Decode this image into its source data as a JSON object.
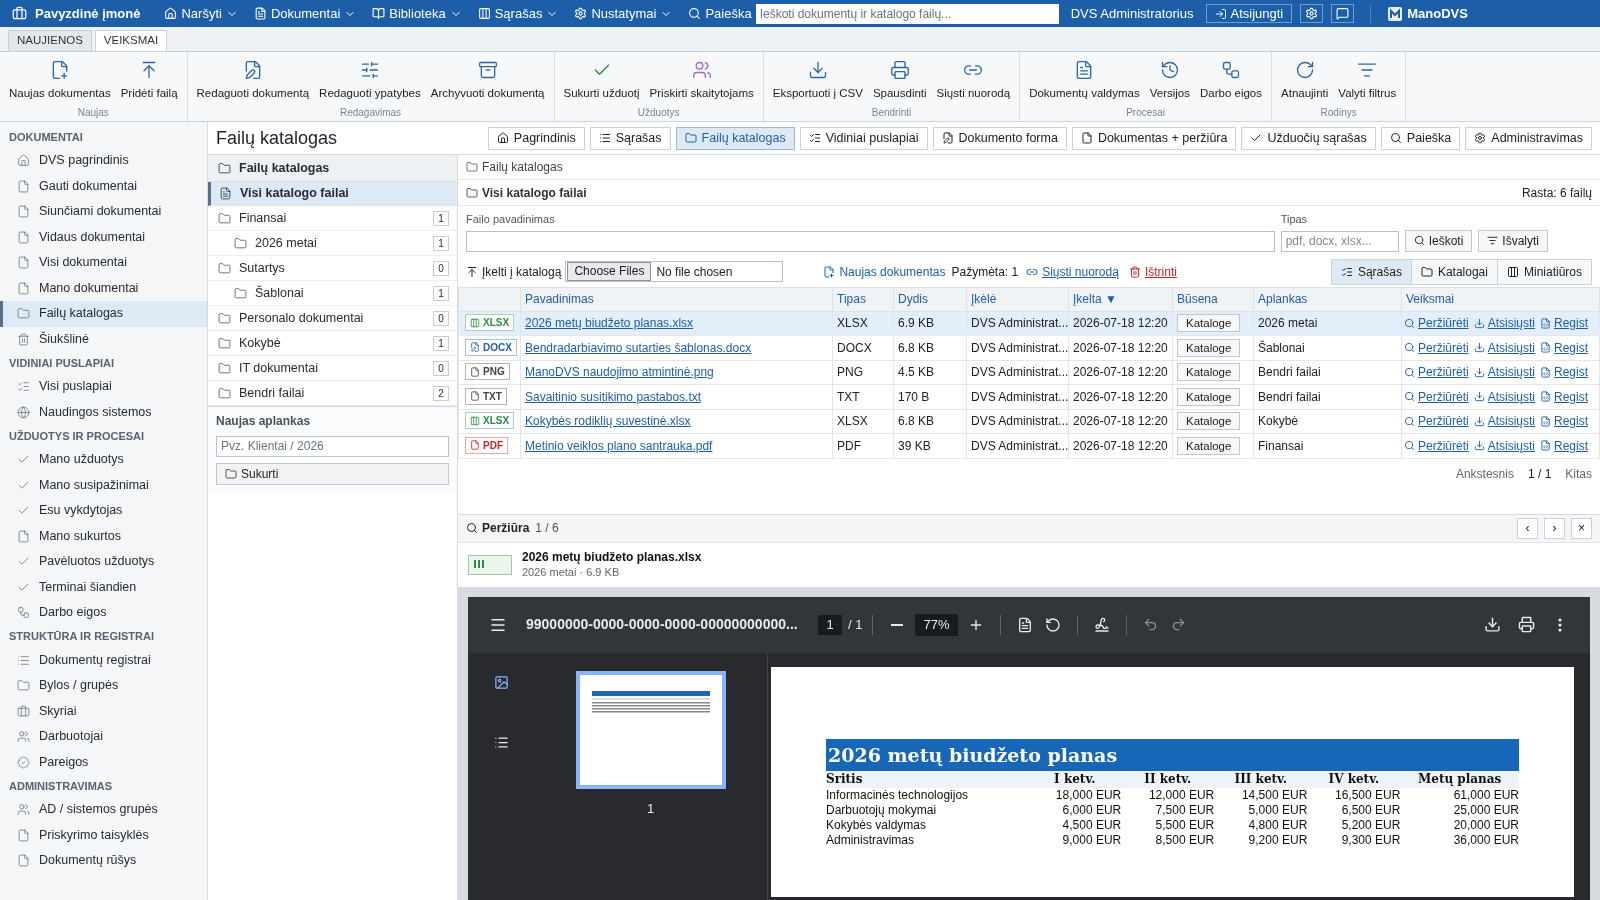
{
  "top_bar": {
    "company": "Pavyzdinė įmonė",
    "menus": [
      {
        "label": "Naršyti"
      },
      {
        "label": "Dokumentai"
      },
      {
        "label": "Biblioteka"
      },
      {
        "label": "Sąrašas"
      },
      {
        "label": "Nustatymai"
      }
    ],
    "search_label": "Paieška",
    "search_placeholder": "Ieškoti dokumentų ir katalogo failų...",
    "user": "DVS Administratorius",
    "logout": "Atsijungti",
    "brand": "ManoDVS"
  },
  "ribbon_tabs": [
    {
      "label": "NAUJIENOS",
      "selected": false
    },
    {
      "label": "VEIKSMAI",
      "selected": true
    }
  ],
  "ribbon_groups": [
    {
      "label": "Naujas",
      "buttons": [
        "Naujas dokumentas",
        "Pridėti failą"
      ]
    },
    {
      "label": "Redagavimas",
      "buttons": [
        "Redaguoti dokumentą",
        "Redaguoti ypatybes",
        "Archyvuoti dokumentą"
      ]
    },
    {
      "label": "Užduotys",
      "buttons": [
        "Sukurti užduotį",
        "Priskirti skaitytojams"
      ]
    },
    {
      "label": "Bendrinti",
      "buttons": [
        "Eksportuoti į CSV",
        "Spausdinti",
        "Siųsti nuorodą"
      ]
    },
    {
      "label": "Procesai",
      "buttons": [
        "Dokumentų valdymas",
        "Versijos",
        "Darbo eigos"
      ]
    },
    {
      "label": "Rodinys",
      "buttons": [
        "Atnaujinti",
        "Valyti filtrus"
      ]
    }
  ],
  "sidebar": {
    "sections": [
      {
        "title": "DOKUMENTAI",
        "items": [
          {
            "label": "DVS pagrindinis",
            "selected": false
          },
          {
            "label": "Gauti dokumentai",
            "selected": false
          },
          {
            "label": "Siunčiami dokumentai",
            "selected": false
          },
          {
            "label": "Vidaus dokumentai",
            "selected": false
          },
          {
            "label": "Visi dokumentai",
            "selected": false
          },
          {
            "label": "Mano dokumentai",
            "selected": false
          },
          {
            "label": "Failų katalogas",
            "selected": true
          },
          {
            "label": "Šiukšlinė",
            "selected": false
          }
        ]
      },
      {
        "title": "VIDINIAI PUSLAPIAI",
        "items": [
          {
            "label": "Visi puslapiai",
            "selected": false
          },
          {
            "label": "Naudingos sistemos",
            "selected": false
          }
        ]
      },
      {
        "title": "UŽDUOTYS IR PROCESAI",
        "items": [
          {
            "label": "Mano užduotys",
            "selected": false
          },
          {
            "label": "Mano susipažinimai",
            "selected": false
          },
          {
            "label": "Esu vykdytojas",
            "selected": false
          },
          {
            "label": "Mano sukurtos",
            "selected": false
          },
          {
            "label": "Pavėluotos užduotys",
            "selected": false
          },
          {
            "label": "Terminai šiandien",
            "selected": false
          },
          {
            "label": "Darbo eigos",
            "selected": false
          }
        ]
      },
      {
        "title": "STRUKTŪRA IR REGISTRAI",
        "items": [
          {
            "label": "Dokumentų registrai",
            "selected": false
          },
          {
            "label": "Bylos / grupės",
            "selected": false
          },
          {
            "label": "Skyriai",
            "selected": false
          },
          {
            "label": "Darbuotojai",
            "selected": false
          },
          {
            "label": "Pareigos",
            "selected": false
          }
        ]
      },
      {
        "title": "ADMINISTRAVIMAS",
        "items": [
          {
            "label": "AD / sistemos grupės",
            "selected": false
          },
          {
            "label": "Priskyrimo taisyklės",
            "selected": false
          },
          {
            "label": "Dokumentų rūšys",
            "selected": false
          }
        ]
      }
    ]
  },
  "page_title": "Failų katalogas",
  "view_tabs": [
    {
      "label": "Pagrindinis",
      "selected": false
    },
    {
      "label": "Sąrašas",
      "selected": false
    },
    {
      "label": "Failų katalogas",
      "selected": true
    },
    {
      "label": "Vidiniai puslapiai",
      "selected": false
    },
    {
      "label": "Dokumento forma",
      "selected": false
    },
    {
      "label": "Dokumentas + peržiūra",
      "selected": false
    },
    {
      "label": "Užduočių sąrašas",
      "selected": false
    },
    {
      "label": "Paieška",
      "selected": false
    },
    {
      "label": "Administravimas",
      "selected": false
    }
  ],
  "folder_tree": {
    "header": "Failų katalogas",
    "all_files": {
      "label": "Visi katalogo failai",
      "selected": true
    },
    "folders": [
      {
        "label": "Finansai",
        "count": "1",
        "selected": false,
        "children": [
          {
            "label": "2026 metai",
            "count": "1",
            "selected": false
          }
        ]
      },
      {
        "label": "Sutartys",
        "count": "0",
        "selected": false,
        "children": [
          {
            "label": "Šablonai",
            "count": "1",
            "selected": false
          }
        ]
      },
      {
        "label": "Personalo dokumentai",
        "count": "0",
        "selected": false
      },
      {
        "label": "Kokybė",
        "count": "1",
        "selected": false
      },
      {
        "label": "IT dokumentai",
        "count": "0",
        "selected": false
      },
      {
        "label": "Bendri failai",
        "count": "2",
        "selected": false
      }
    ]
  },
  "new_folder": {
    "title": "Naujas aplankas",
    "placeholder": "Pvz. Klientai / 2026",
    "button": "Sukurti"
  },
  "breadcrumb": "Failų katalogas",
  "listing": {
    "title": "Visi katalogo failai",
    "found": "Rasta: 6 failų"
  },
  "filters": {
    "name_label": "Failo pavadinimas",
    "type_label": "Tipas",
    "type_placeholder": "pdf, docx, xlsx...",
    "search_button": "Ieškoti",
    "clear_button": "Išvalyti"
  },
  "toolbar": {
    "upload_label": "Įkelti į katalogą",
    "choose_files": "Choose Files",
    "no_file": "No file chosen",
    "new_document": "Naujas dokumentas",
    "marked": "Pažymėta: 1",
    "send_link": "Siųsti nuorodą",
    "delete": "Ištrinti",
    "view_modes": [
      {
        "label": "Sąrašas",
        "selected": true
      },
      {
        "label": "Katalogai",
        "selected": false
      },
      {
        "label": "Miniatiūros",
        "selected": false
      }
    ]
  },
  "table": {
    "columns": [
      "Pavadinimas",
      "Tipas",
      "Dydis",
      "Įkėlė",
      "Įkelta ▼",
      "Būsena",
      "Aplankas",
      "Veiksmai"
    ],
    "rows": [
      {
        "kind": "spreadsheet",
        "badge": "XLSX",
        "color": "#2e8b47",
        "name": "2026 metų biudžeto planas.xlsx",
        "type": "XLSX",
        "size": "6.9 KB",
        "uploader": "DVS Administrat...",
        "uploaded": "2026-07-18 12:20",
        "status": "Kataloge",
        "folder": "2026 metai",
        "actions": [
          "Peržiūrėti",
          "Atsisiųsti",
          "Regist"
        ],
        "selected": true
      },
      {
        "kind": "document",
        "badge": "DOCX",
        "color": "#1f5fa8",
        "name": "Bendradarbiavimo sutarties šablonas.docx",
        "type": "DOCX",
        "size": "6.8 KB",
        "uploader": "DVS Administrat...",
        "uploaded": "2026-07-18 12:20",
        "status": "Kataloge",
        "folder": "Šablonai",
        "actions": [
          "Peržiūrėti",
          "Atsisiųsti",
          "Regist"
        ],
        "selected": false
      },
      {
        "kind": "file",
        "badge": "PNG",
        "color": "#444444",
        "name": "ManoDVS naudojimo atmintinė.png",
        "type": "PNG",
        "size": "4.5 KB",
        "uploader": "DVS Administrat...",
        "uploaded": "2026-07-18 12:20",
        "status": "Kataloge",
        "folder": "Bendri failai",
        "actions": [
          "Peržiūrėti",
          "Atsisiųsti",
          "Regist"
        ],
        "selected": false
      },
      {
        "kind": "file",
        "badge": "TXT",
        "color": "#444444",
        "name": "Savaitinio susitikimo pastabos.txt",
        "type": "TXT",
        "size": "170 B",
        "uploader": "DVS Administrat...",
        "uploaded": "2026-07-18 12:20",
        "status": "Kataloge",
        "folder": "Bendri failai",
        "actions": [
          "Peržiūrėti",
          "Atsisiųsti",
          "Regist"
        ],
        "selected": false
      },
      {
        "kind": "spreadsheet",
        "badge": "XLSX",
        "color": "#2e8b47",
        "name": "Kokybės rodiklių suvestinė.xlsx",
        "type": "XLSX",
        "size": "6.8 KB",
        "uploader": "DVS Administrat...",
        "uploaded": "2026-07-18 12:20",
        "status": "Kataloge",
        "folder": "Kokybė",
        "actions": [
          "Peržiūrėti",
          "Atsisiųsti",
          "Regist"
        ],
        "selected": false
      },
      {
        "kind": "file",
        "badge": "PDF",
        "color": "#c62828",
        "name": "Metinio veiklos plano santrauka.pdf",
        "type": "PDF",
        "size": "39 KB",
        "uploader": "DVS Administrat...",
        "uploaded": "2026-07-18 12:20",
        "status": "Kataloge",
        "folder": "Finansai",
        "actions": [
          "Peržiūrėti",
          "Atsisiųsti",
          "Regist"
        ],
        "selected": false
      }
    ]
  },
  "pager": {
    "prev": "Ankstesnis",
    "page": "1 / 1",
    "next": "Kitas"
  },
  "preview": {
    "title": "Peržiūra",
    "counter": "1 / 6",
    "prev": "‹",
    "next": "›",
    "close": "×",
    "file_name": "2026 metų biudžeto planas.xlsx",
    "file_meta": "2026 metai · 6.9 KB",
    "viewer": {
      "file_name": "99000000-0000-0000-0000-00000000000...",
      "page": "1",
      "page_of": "/ 1",
      "zoom": "77%",
      "thumb_label": "1",
      "document": {
        "title": "2026 metų biudžeto planas",
        "columns": [
          "Sritis",
          "I ketv.",
          "II ketv.",
          "III ketv.",
          "IV ketv.",
          "Metų planas"
        ],
        "rows": [
          [
            "Informacinės technologijos",
            "18,000 EUR",
            "12,000 EUR",
            "14,500 EUR",
            "16,500 EUR",
            "61,000 EUR"
          ],
          [
            "Darbuotojų mokymai",
            "6,000 EUR",
            "7,500 EUR",
            "5,000 EUR",
            "6,500 EUR",
            "25,000 EUR"
          ],
          [
            "Kokybės valdymas",
            "4,500 EUR",
            "5,500 EUR",
            "4,800 EUR",
            "5,200 EUR",
            "20,000 EUR"
          ],
          [
            "Administravimas",
            "9,000 EUR",
            "8,500 EUR",
            "9,200 EUR",
            "9,300 EUR",
            "36,000 EUR"
          ]
        ]
      }
    }
  }
}
